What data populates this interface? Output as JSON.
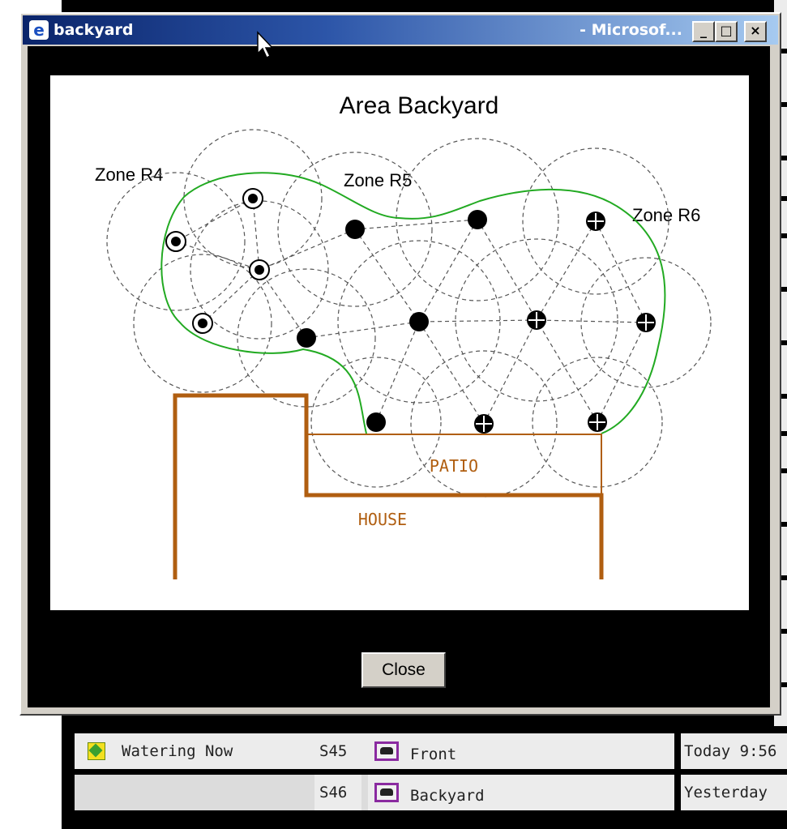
{
  "window": {
    "title": "backyard",
    "title_suffix": "- Microsof...",
    "minimize_glyph": "_",
    "maximize_glyph": "□",
    "close_glyph": "×"
  },
  "map": {
    "title": "Area Backyard",
    "zones": [
      "Zone R4",
      "Zone R5",
      "Zone R6"
    ],
    "patio_label": "PATIO",
    "house_label": "HOUSE",
    "colors": {
      "lawn_outline": "#22aa22",
      "building": "#b05e10",
      "spray_lines": "#555555"
    }
  },
  "close_button": {
    "label": "Close"
  },
  "background_table": {
    "rows": [
      {
        "status": "Watering Now",
        "station": "S45",
        "area": "Front",
        "time": "Today 9:56"
      },
      {
        "status": "",
        "station": "S46",
        "area": "Backyard",
        "time": "Yesterday"
      }
    ]
  },
  "icons": {
    "app": "ie-icon",
    "status": "watering-icon",
    "area": "map-thumbnail-icon",
    "pointer": "mouse-cursor-icon"
  }
}
